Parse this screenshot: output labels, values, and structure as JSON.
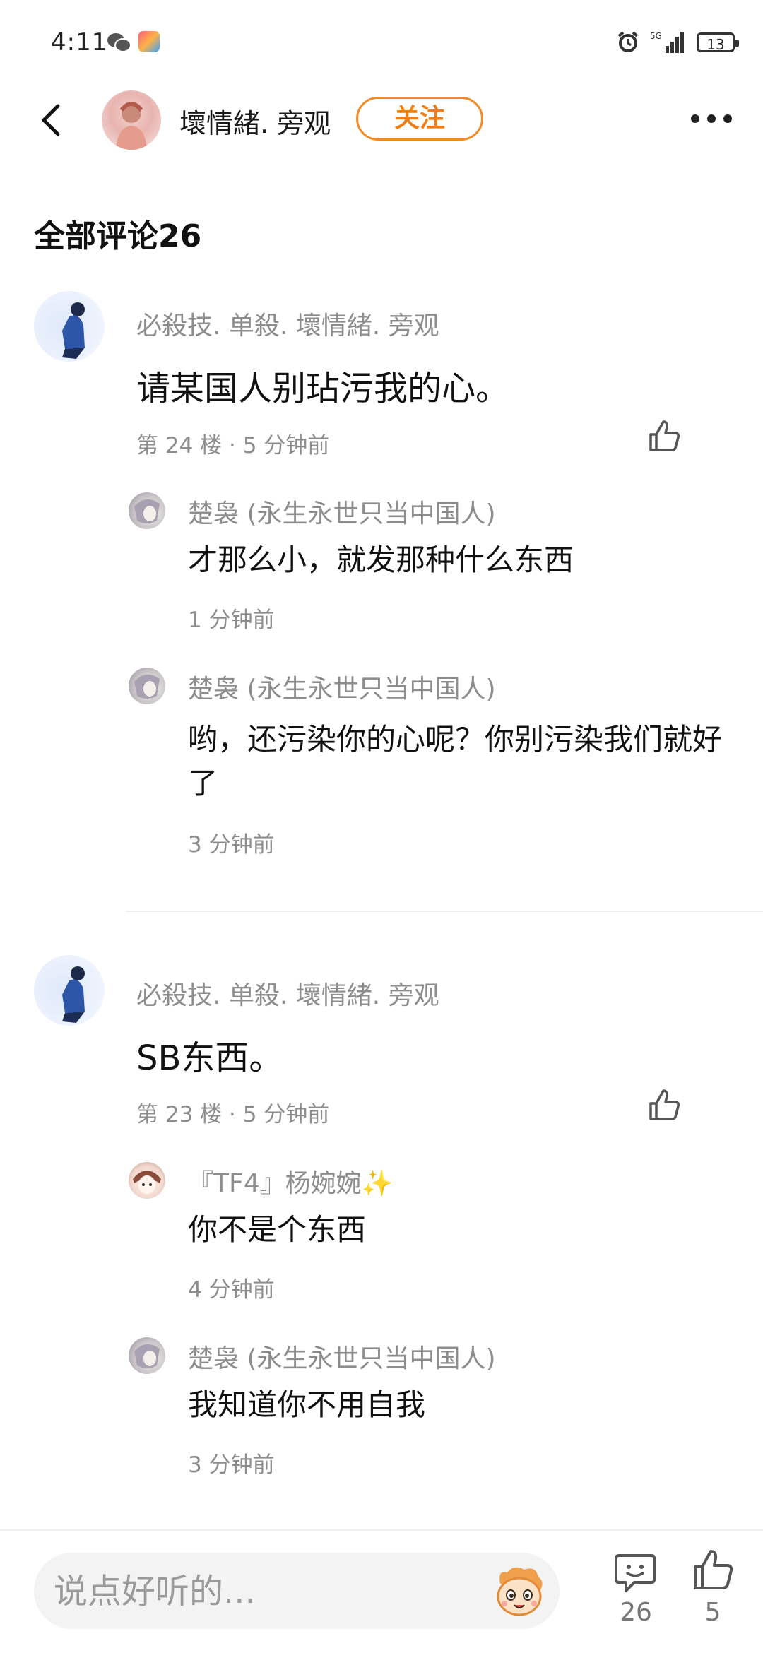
{
  "status_bar": {
    "time": "4:11",
    "network": "5G",
    "battery": "13"
  },
  "header": {
    "username": "壞情緒. 旁观",
    "follow_label": "关注"
  },
  "section_title": "全部评论26",
  "comments": [
    {
      "author": "必殺技. 单殺. 壞情緒. 旁观",
      "text": "请某国人别玷污我的心。",
      "meta": "第 24 楼 · 5 分钟前",
      "replies": [
        {
          "author": "楚袅 (永生永世只当中国人)",
          "text": "才那么小，就发那种什么东西",
          "time": "1 分钟前"
        },
        {
          "author": "楚袅 (永生永世只当中国人)",
          "text": "哟，还污染你的心呢？你别污染我们就好了",
          "time": "3 分钟前"
        }
      ]
    },
    {
      "author": "必殺技. 单殺. 壞情緒. 旁观",
      "text": "SB东西。",
      "meta": "第 23 楼 · 5 分钟前",
      "replies": [
        {
          "author": "『TF4』杨婉婉✨",
          "text": "你不是个东西",
          "time": "4 分钟前"
        },
        {
          "author": "楚袅 (永生永世只当中国人)",
          "text": "我知道你不用自我",
          "time": "3 分钟前"
        }
      ]
    }
  ],
  "bottom_bar": {
    "input_placeholder": "说点好听的...",
    "comment_count": "26",
    "like_count": "5"
  },
  "colors": {
    "accent": "#f28b25",
    "secondary_text": "#8d8d8d"
  },
  "icons": [
    "back-arrow-icon",
    "more-dots-icon",
    "thumbs-up-icon",
    "comment-icon",
    "emoji-face-icon",
    "alarm-icon",
    "wechat-icon"
  ]
}
